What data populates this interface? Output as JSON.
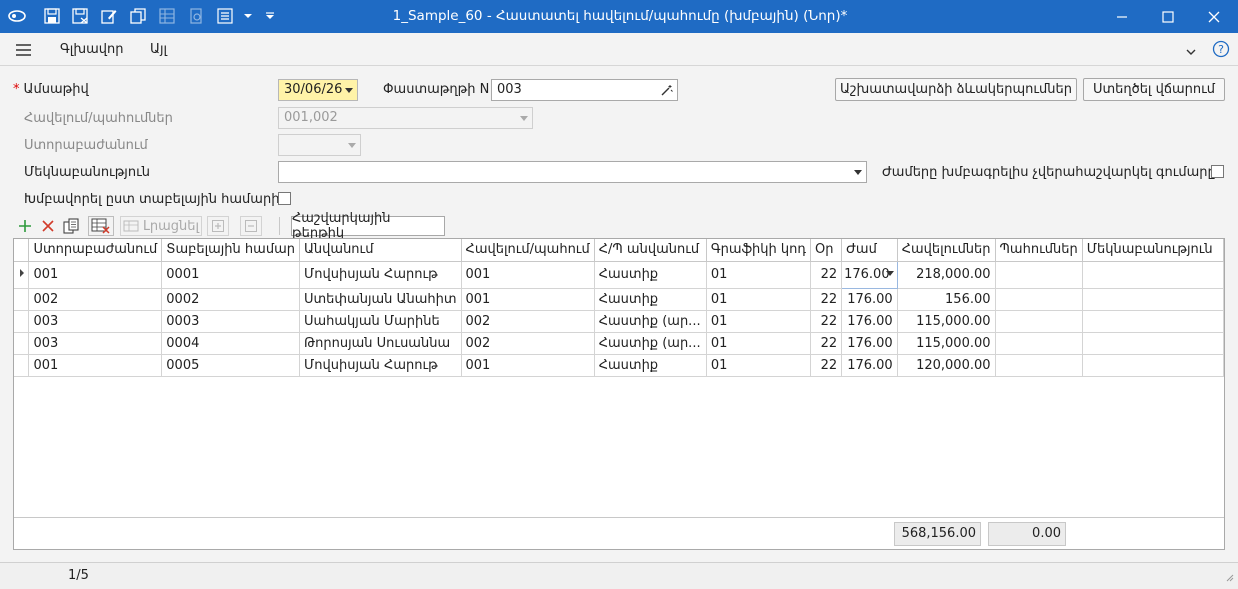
{
  "window": {
    "title": "1_Sample_60 - Հաստատել հավելում/պահումը (խմբային) (Նոր)*"
  },
  "menu": {
    "main_label": "Գլխավոր",
    "other_label": "Այլ"
  },
  "form": {
    "date_label": "Ամսաթիվ",
    "date_value": "30/06/26",
    "doc_no_label": "Փաստաթղթի N",
    "doc_no_value": "003",
    "additions_label": "Հավելում/պահումներ",
    "additions_value": "001,002",
    "subdivision_label": "Ստորաբաժանում",
    "subdivision_value": "",
    "comment_label": "Մեկնաբանություն",
    "comment_value": "",
    "no_recalc_label": "Ժամերը խմբագրելիս չվերահաշվարկել գումարը",
    "group_label": "Խմբավորել ըստ տաբելային համարի",
    "workplace_settings_button": "Աշխատավարձի ձևակերպումներ",
    "create_payment_button": "Ստեղծել վճարում"
  },
  "grid_toolbar": {
    "fill_button": "Լրացնել",
    "calc_sheet_button": "Հաշվարկային թերթիկ"
  },
  "grid": {
    "columns": [
      "Ստորաբաժանում",
      "Տաբելային համար",
      "Անվանում",
      "Հավելում/պահում",
      "Հ/Պ անվանում",
      "Գրաֆիկի կոդ",
      "Օր",
      "Ժամ",
      "Հավելումներ",
      "Պահումներ",
      "Մեկնաբանություն"
    ],
    "rows": [
      {
        "sub": "001",
        "tab": "0001",
        "name": "Մովսիսյան Հարութ",
        "code": "001",
        "cname": "Հաստիք",
        "sched": "01",
        "days": "22",
        "hours": "176.00",
        "add": "218,000.00",
        "ded": "",
        "comment": ""
      },
      {
        "sub": "002",
        "tab": "0002",
        "name": "Ստեփանյան Անահիտ",
        "code": "001",
        "cname": "Հաստիք",
        "sched": "01",
        "days": "22",
        "hours": "176.00",
        "add": "156.00",
        "ded": "",
        "comment": ""
      },
      {
        "sub": "003",
        "tab": "0003",
        "name": "Սահակյան Մարինե",
        "code": "002",
        "cname": "Հաստիք (ար...",
        "sched": "01",
        "days": "22",
        "hours": "176.00",
        "add": "115,000.00",
        "ded": "",
        "comment": ""
      },
      {
        "sub": "003",
        "tab": "0004",
        "name": "Թորոսյան Սուսաննա",
        "code": "002",
        "cname": "Հաստիք (ար...",
        "sched": "01",
        "days": "22",
        "hours": "176.00",
        "add": "115,000.00",
        "ded": "",
        "comment": ""
      },
      {
        "sub": "001",
        "tab": "0005",
        "name": "Մովսիսյան Հարութ",
        "code": "001",
        "cname": "Հաստիք",
        "sched": "01",
        "days": "22",
        "hours": "176.00",
        "add": "120,000.00",
        "ded": "",
        "comment": ""
      }
    ],
    "total_additions": "568,156.00",
    "total_deductions": "0.00"
  },
  "status": {
    "pager": "1/5"
  },
  "colors": {
    "titlebar": "#1f6bc4",
    "date_bg": "#fff3a8",
    "required": "#dd0000",
    "add_icon": "#2e9a3c",
    "delete_icon": "#d23b2a"
  }
}
